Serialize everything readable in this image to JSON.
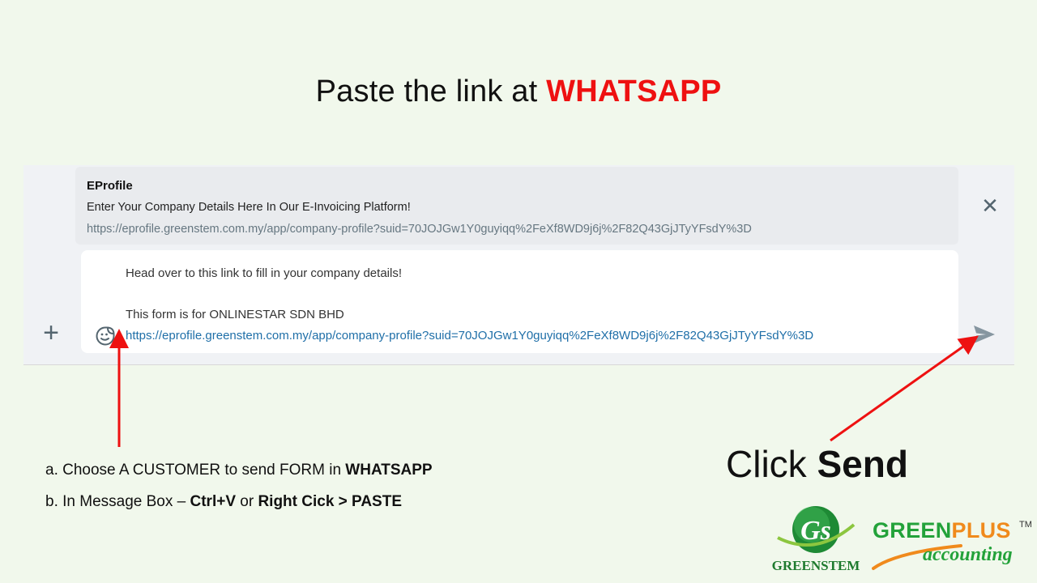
{
  "title": {
    "prefix": "Paste the link at ",
    "highlight": "WHATSAPP"
  },
  "preview": {
    "title": "EProfile",
    "description": "Enter Your Company Details Here In Our E-Invoicing Platform!",
    "url": "https://eprofile.greenstem.com.my/app/company-profile?suid=70JOJGw1Y0guyiqq%2FeXf8WD9j6j%2F82Q43GjJTyYFsdY%3D"
  },
  "message": {
    "line1": "Head over to this link to fill in your company details!",
    "line2": "This form is for ONLINESTAR SDN BHD",
    "link": "https://eprofile.greenstem.com.my/app/company-profile?suid=70JOJGw1Y0guyiqq%2FeXf8WD9j6j%2F82Q43GjJTyYFsdY%3D"
  },
  "icons": {
    "close": "close-icon",
    "attach": "plus-icon",
    "emoji": "emoji-sticker-icon",
    "send": "send-icon"
  },
  "instructions": {
    "a_prefix": "a. Choose A CUSTOMER to send FORM in ",
    "a_bold": "WHATSAPP",
    "b_prefix": "b. In Message Box – ",
    "b_bold1": "Ctrl+V",
    "b_mid": " or ",
    "b_bold2": "Right Cick > PASTE"
  },
  "callout": {
    "prefix": "Click ",
    "bold": "Send"
  },
  "branding": {
    "greenstem": "GREENSTEM",
    "greenstem_initials": "Gs",
    "greenplus_green": "GREEN",
    "greenplus_orange": "PLUS",
    "trademark": "TM",
    "accounting": "accounting"
  },
  "colors": {
    "background": "#f1f8ec",
    "highlight": "#ee1111",
    "arrow": "#ee1111",
    "link": "#1f6fa8",
    "brand_green": "#23a23a",
    "brand_orange": "#f08a1c"
  }
}
